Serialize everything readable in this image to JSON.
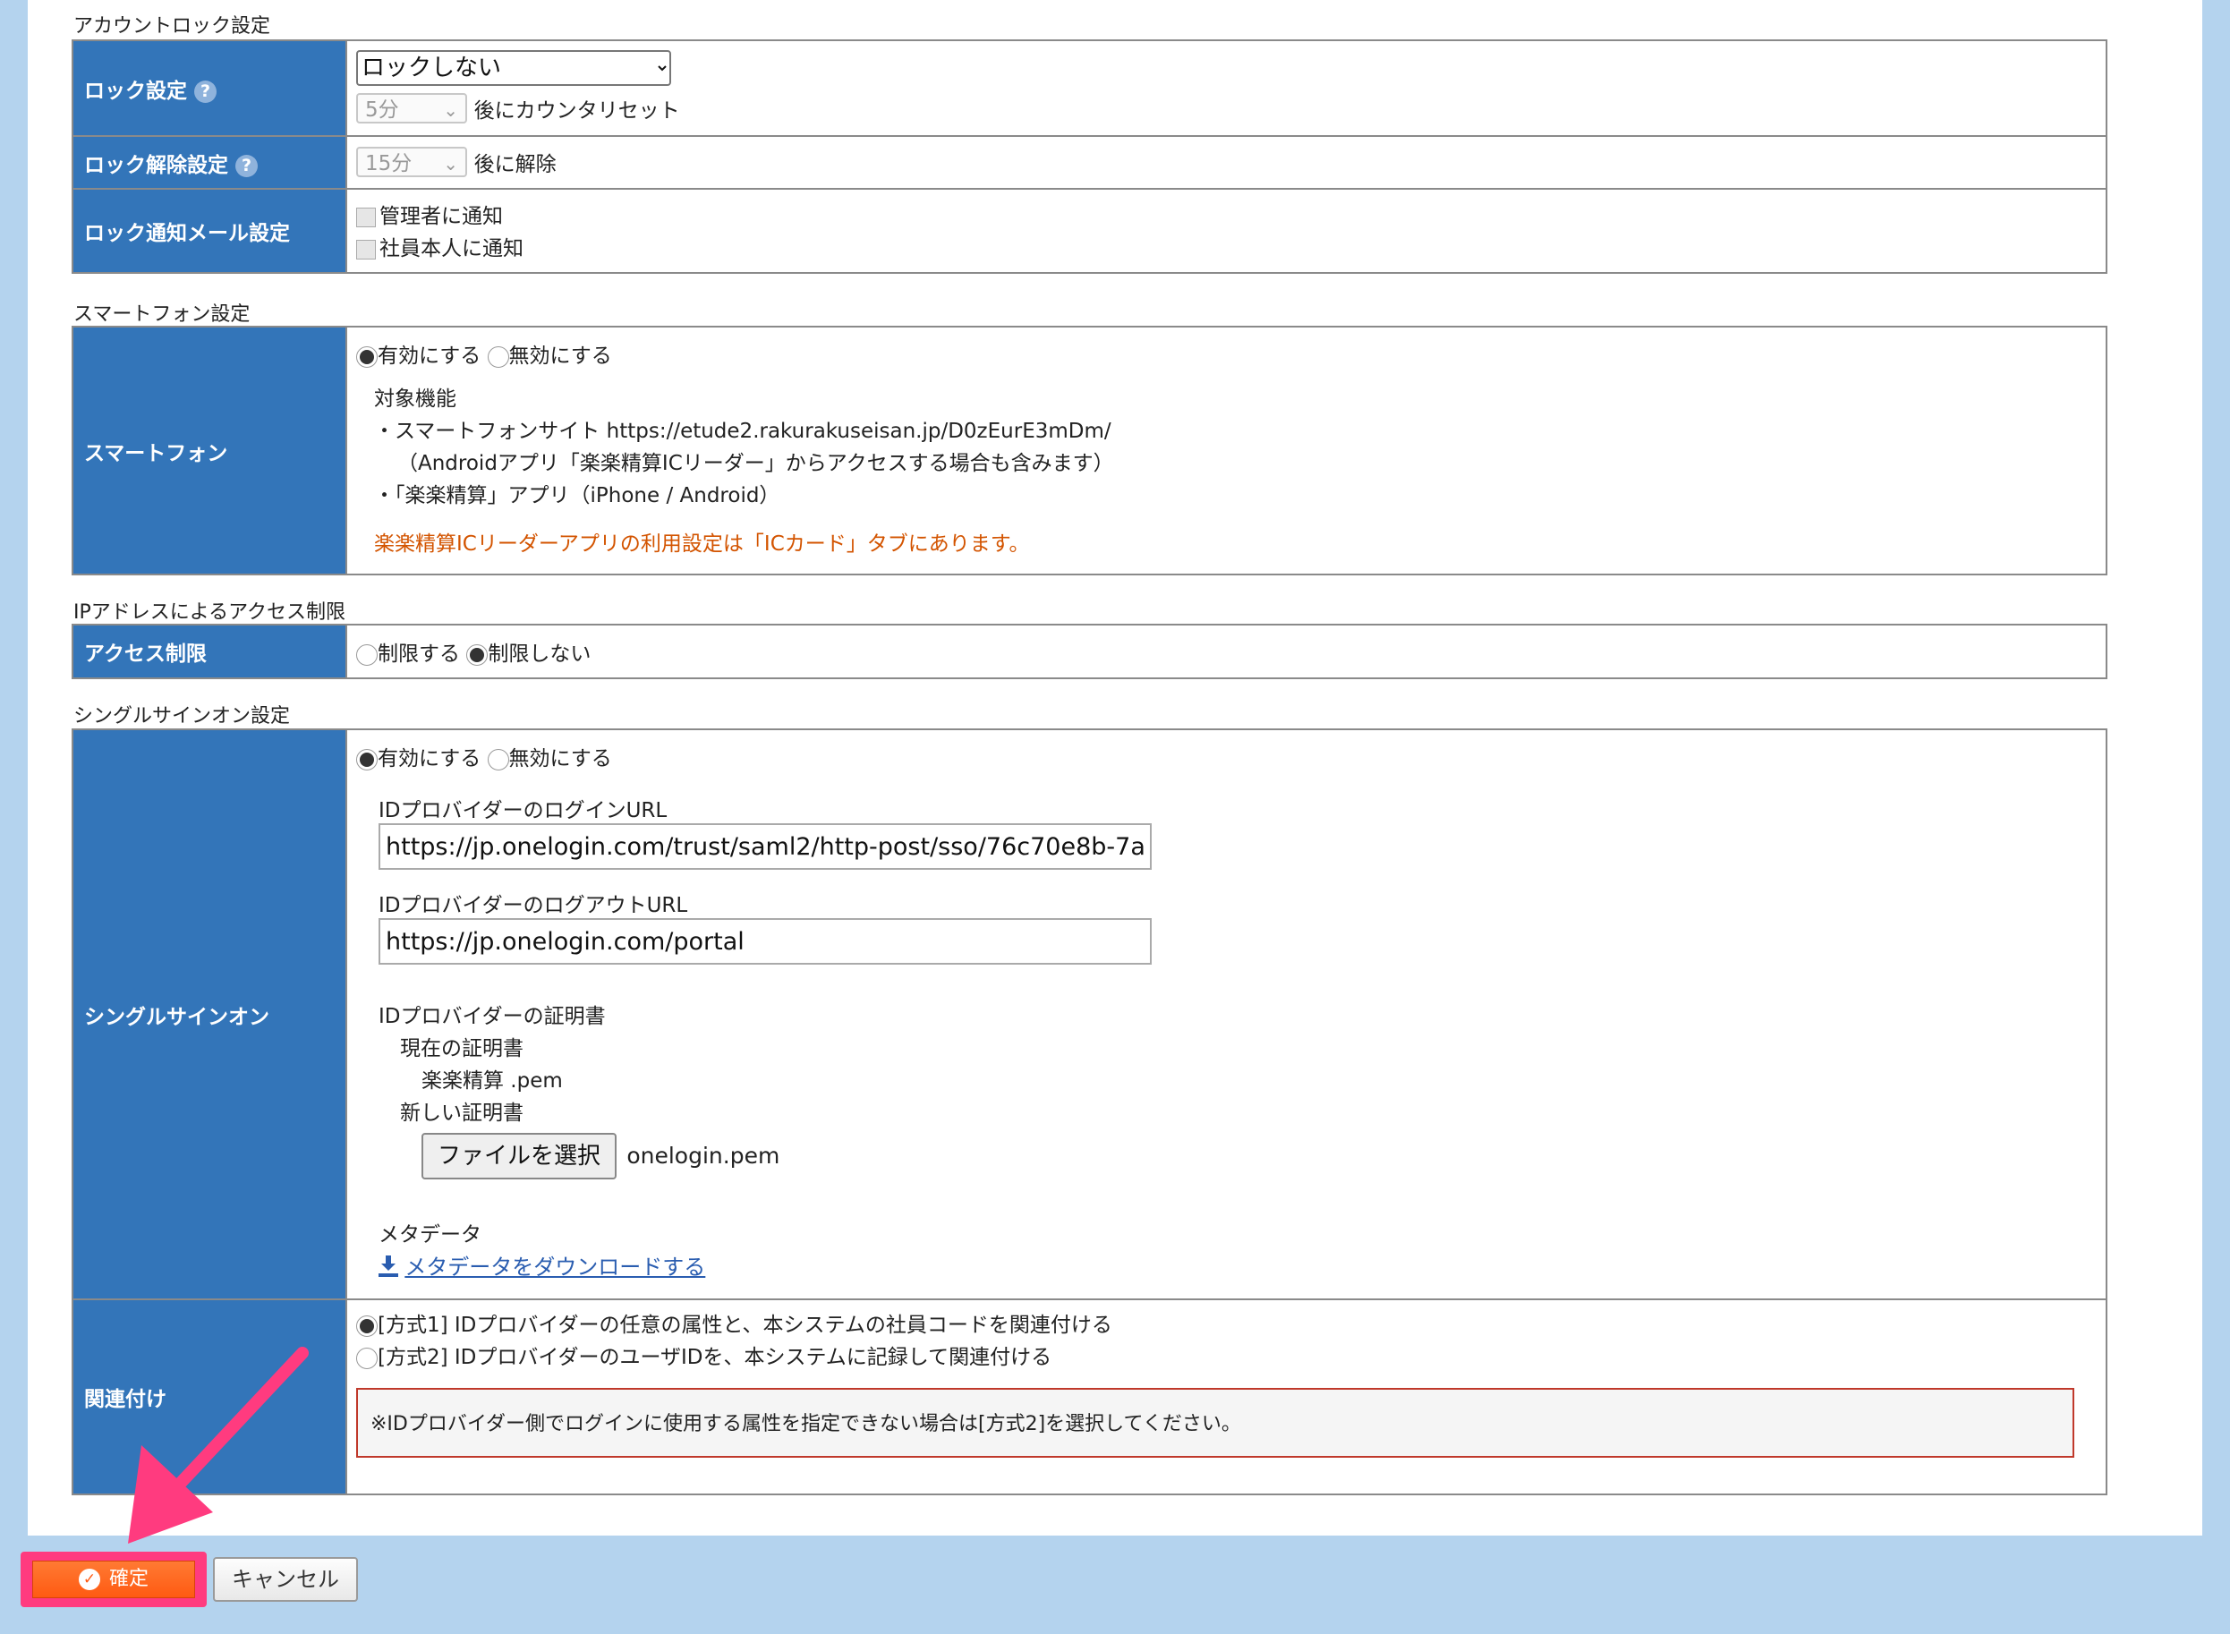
{
  "account_lock": {
    "section_title": "アカウントロック設定",
    "lock_setting_label": "ロック設定",
    "lock_setting_value": "ロックしない",
    "counter_reset_value": "5分",
    "counter_reset_suffix": "後にカウンタリセット",
    "unlock_label": "ロック解除設定",
    "unlock_value": "15分",
    "unlock_suffix": "後に解除",
    "notify_label": "ロック通知メール設定",
    "notify_admin": "管理者に通知",
    "notify_employee": "社員本人に通知"
  },
  "smartphone": {
    "section_title": "スマートフォン設定",
    "row_label": "スマートフォン",
    "enable": "有効にする",
    "disable": "無効にする",
    "selected": "enable",
    "target_title": "対象機能",
    "target_line1": "・スマートフォンサイト https://etude2.rakurakuseisan.jp/D0zEurE3mDm/",
    "target_line2": "（Androidアプリ「楽楽精算ICリーダー」からアクセスする場合も含みます）",
    "target_line3": "・「楽楽精算」アプリ（iPhone / Android）",
    "ic_note": "楽楽精算ICリーダーアプリの利用設定は「ICカード」タブにあります。"
  },
  "ip_restriction": {
    "section_title": "IPアドレスによるアクセス制限",
    "row_label": "アクセス制限",
    "restrict": "制限する",
    "no_restrict": "制限しない",
    "selected": "no_restrict"
  },
  "sso": {
    "section_title": "シングルサインオン設定",
    "row_label": "シングルサインオン",
    "enable": "有効にする",
    "disable": "無効にする",
    "selected": "enable",
    "login_url_label": "IDプロバイダーのログインURL",
    "login_url_value": "https://jp.onelogin.com/trust/saml2/http-post/sso/76c70e8b-7a",
    "logout_url_label": "IDプロバイダーのログアウトURL",
    "logout_url_value": "https://jp.onelogin.com/portal",
    "cert_label": "IDプロバイダーの証明書",
    "current_cert_label": "現在の証明書",
    "current_cert_value": "楽楽精算 .pem",
    "new_cert_label": "新しい証明書",
    "file_button": "ファイルを選択",
    "file_name": "onelogin.pem",
    "metadata_label": "メタデータ",
    "metadata_link": "メタデータをダウンロードする",
    "mapping_label": "関連付け",
    "method1": "[方式1] IDプロバイダーの任意の属性と、本システムの社員コードを関連付ける",
    "method2": "[方式2] IDプロバイダーのユーザIDを、本システムに記録して関連付ける",
    "method_selected": "method1",
    "mapping_note": "※IDプロバイダー側でログインに使用する属性を指定できない場合は[方式2]を選択してください。"
  },
  "footer": {
    "confirm": "確定",
    "cancel": "キャンセル"
  },
  "colors": {
    "header_cell": "#3375b9",
    "page_bg": "#b4d3ee",
    "confirm_button": "#ff5a12",
    "highlight": "#ff3b7f",
    "note_text": "#d35400"
  },
  "icons": {
    "help": "question-circle-icon",
    "check": "check-circle-icon",
    "download": "download-icon",
    "arrow": "pink-arrow-annotation"
  }
}
